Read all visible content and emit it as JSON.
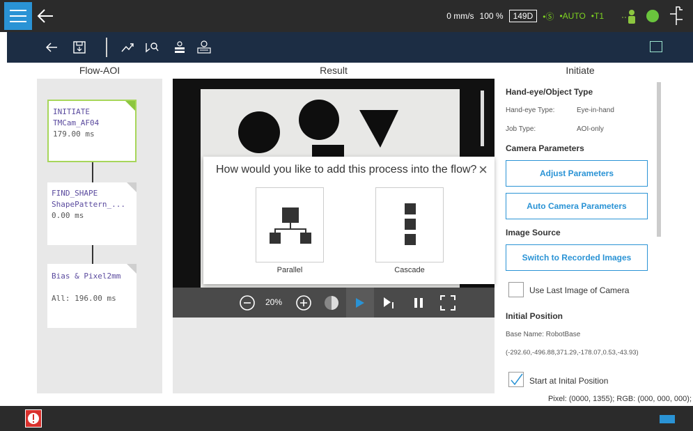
{
  "status": {
    "speed": "0 mm/s",
    "percent": "100 %",
    "project_code": "149D",
    "mode_indicator": "•Ⓢ",
    "auto_mode": "•AUTO",
    "tool": "•T1"
  },
  "panels": {
    "flow_title": "Flow-AOI",
    "result_title": "Result",
    "initiate_title": "Initiate"
  },
  "flow": {
    "cards": [
      {
        "line1": "INITIATE",
        "line2": "TMCam_AF04",
        "line3": "179.00 ms"
      },
      {
        "line1": "FIND_SHAPE",
        "line2": "ShapePattern_...",
        "line3": "0.00 ms"
      },
      {
        "line1": "Bias & Pixel2mm",
        "line2": "All: 196.00 ms"
      }
    ]
  },
  "viewer": {
    "zoom": "20%"
  },
  "dialog": {
    "question": "How would you like to add this process into the flow?",
    "option_parallel": "Parallel",
    "option_cascade": "Cascade"
  },
  "initiate": {
    "section_handeye": "Hand-eye/Object Type",
    "handeye_key": "Hand-eye Type:",
    "handeye_val": "Eye-in-hand",
    "job_key": "Job Type:",
    "job_val": "AOI-only",
    "section_camera": "Camera Parameters",
    "btn_adjust": "Adjust Parameters",
    "btn_auto": "Auto Camera Parameters",
    "section_image": "Image Source",
    "btn_switch": "Switch to Recorded Images",
    "chk_last_image": "Use Last Image of Camera",
    "section_position": "Initial Position",
    "base_name": "Base Name: RobotBase",
    "coords": "(-292.60,-496.88,371.29,-178.07,0.53,-43.93)",
    "chk_start": "Start at Inital Position"
  },
  "pixel_info": "Pixel: (0000, 1355); RGB: (000, 000, 000);",
  "colors": {
    "accent": "#2a93d5",
    "active_card": "#a7d65a",
    "toolbar": "#1c2d44"
  }
}
